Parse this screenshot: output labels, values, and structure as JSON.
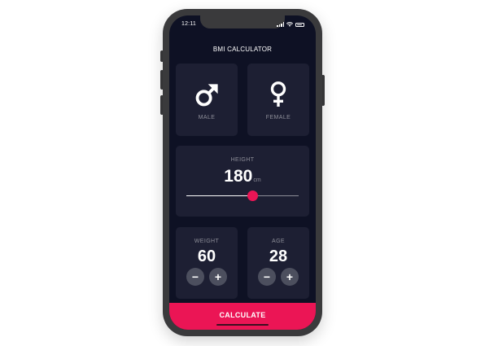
{
  "status_bar": {
    "time": "12:11"
  },
  "app": {
    "title": "BMI CALCULATOR"
  },
  "gender": {
    "male_label": "MALE",
    "female_label": "FEMALE",
    "male_icon": "male-symbol-icon",
    "female_icon": "female-symbol-icon"
  },
  "height": {
    "label": "HEIGHT",
    "value": "180",
    "unit": "cm",
    "slider_fraction": 0.59
  },
  "weight": {
    "label": "WEIGHT",
    "value": "60",
    "minus": "−",
    "plus": "+"
  },
  "age": {
    "label": "AGE",
    "value": "28",
    "minus": "−",
    "plus": "+"
  },
  "actions": {
    "calculate_label": "CALCULATE"
  },
  "colors": {
    "background": "#0e1124",
    "card": "#1d1f33",
    "accent": "#eb1555",
    "inactive_text": "#8d8e98",
    "round_button": "#4c4f5e"
  }
}
